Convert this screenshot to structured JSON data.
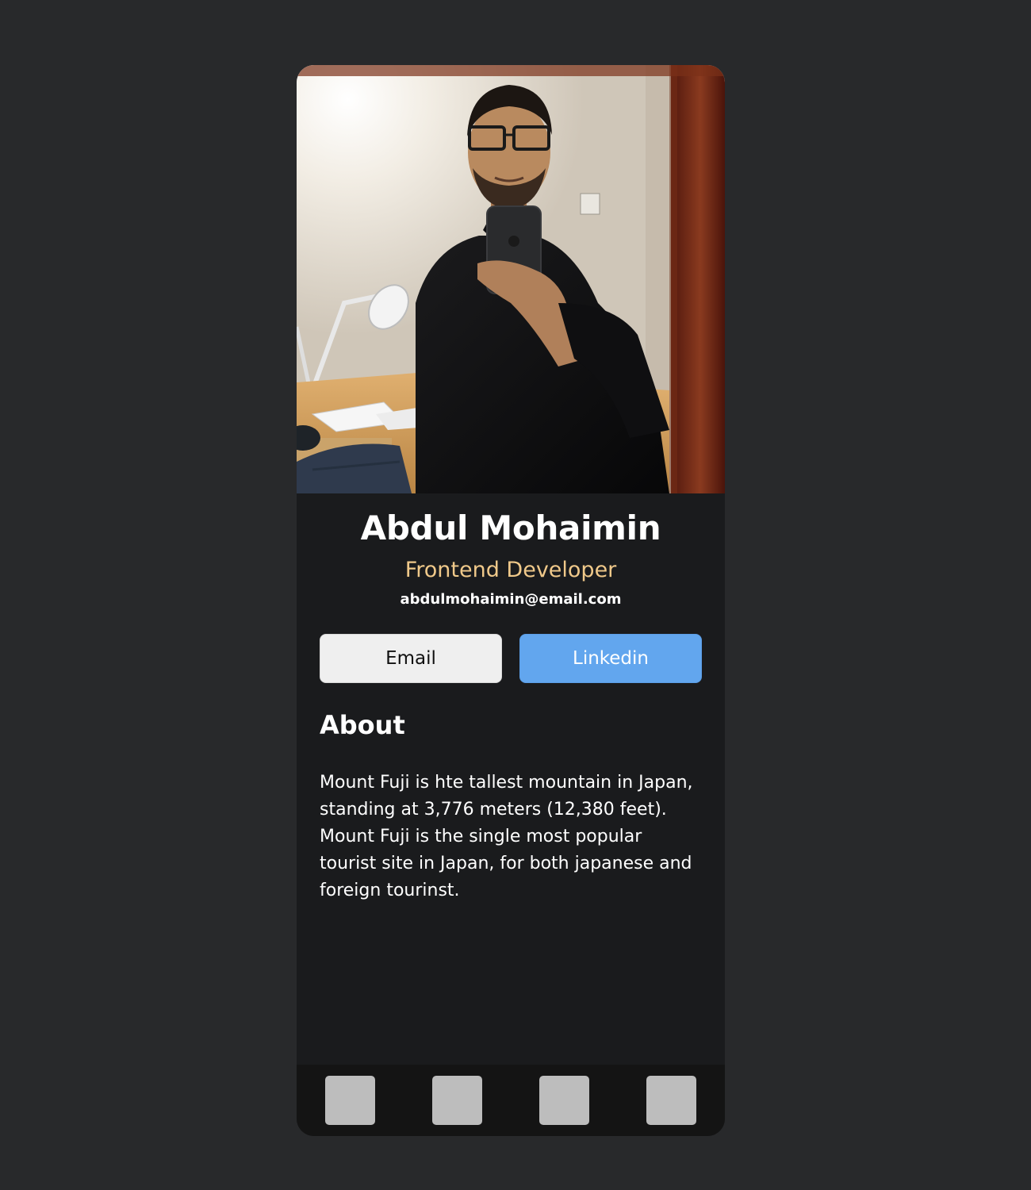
{
  "profile": {
    "photo_alt": "Profile photo",
    "name": "Abdul Mohaimin",
    "role": "Frontend Developer",
    "email": "abdulmohaimin@email.com"
  },
  "actions": {
    "email_label": "Email",
    "linkedin_label": "Linkedin"
  },
  "about": {
    "heading": "About",
    "text": "Mount Fuji is hte tallest mountain in Japan, standing at 3,776 meters (12,380 feet). Mount Fuji is the single most popular tourist site in Japan, for both japanese and foreign tourinst."
  },
  "footer": {
    "icons": [
      "footer-icon-1",
      "footer-icon-2",
      "footer-icon-3",
      "footer-icon-4"
    ]
  },
  "colors": {
    "page_background": "#28292b",
    "card_background": "#1a1b1d",
    "role_accent": "#f0c98a",
    "linkedin_button": "#62a6ee",
    "email_button": "#efefef",
    "footer_background": "#141414",
    "footer_icon": "#bdbdbd"
  }
}
